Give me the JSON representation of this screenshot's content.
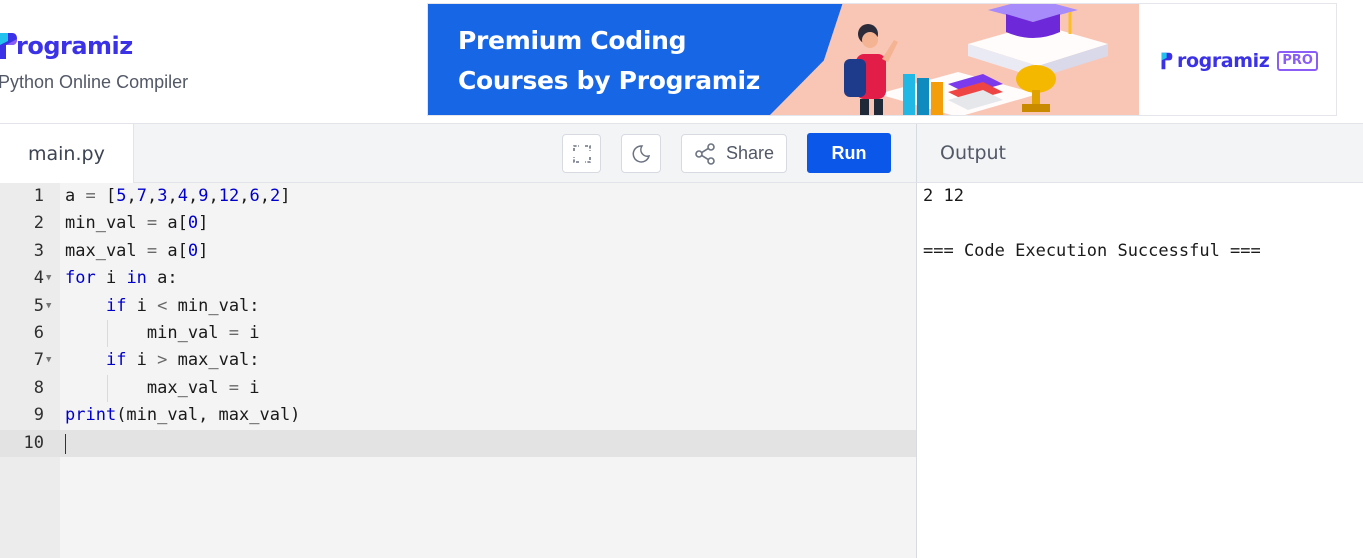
{
  "header": {
    "logo_text": "rogramiz",
    "subtitle": "Python Online Compiler"
  },
  "banner": {
    "line1": "Premium Coding",
    "line2": "Courses by Programiz",
    "pro_logo_text": "rogramiz",
    "pro_badge": "PRO"
  },
  "toolbar": {
    "file_tab": "main.py",
    "fullscreen_icon": "fullscreen-icon",
    "theme_icon": "moon-icon",
    "share_icon": "share-icon",
    "share_label": "Share",
    "run_label": "Run"
  },
  "output_panel": {
    "title": "Output",
    "lines": [
      "2 12",
      "",
      "=== Code Execution Successful ==="
    ]
  },
  "editor": {
    "active_line": 10,
    "lines": [
      {
        "n": "1",
        "fold": false,
        "code": "a = [5,7,3,4,9,12,6,2]"
      },
      {
        "n": "2",
        "fold": false,
        "code": "min_val = a[0]"
      },
      {
        "n": "3",
        "fold": false,
        "code": "max_val = a[0]"
      },
      {
        "n": "4",
        "fold": true,
        "code": "for i in a:"
      },
      {
        "n": "5",
        "fold": true,
        "code": "    if i < min_val:"
      },
      {
        "n": "6",
        "fold": false,
        "code": "        min_val = i"
      },
      {
        "n": "7",
        "fold": true,
        "code": "    if i > max_val:"
      },
      {
        "n": "8",
        "fold": false,
        "code": "        max_val = i"
      },
      {
        "n": "9",
        "fold": false,
        "code": "print(min_val, max_val)"
      },
      {
        "n": "10",
        "fold": false,
        "code": ""
      }
    ]
  },
  "colors": {
    "brand": "#3b31e6",
    "run_button": "#0b57ea",
    "banner_blue": "#1766e6",
    "keyword": "#0000cc"
  }
}
